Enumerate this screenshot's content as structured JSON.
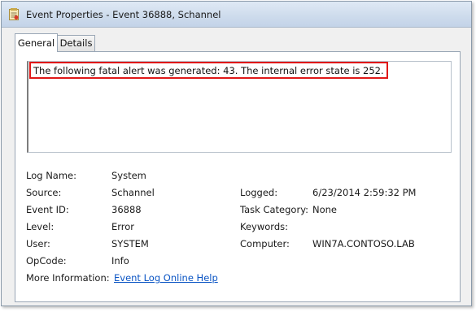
{
  "window": {
    "title": "Event Properties - Event 36888, Schannel",
    "icon": "event-log-icon"
  },
  "tabs": [
    {
      "label": "General",
      "selected": true
    },
    {
      "label": "Details",
      "selected": false
    }
  ],
  "description": "The following fatal alert was generated: 43. The internal error state is 252.",
  "properties": {
    "log_name": {
      "label": "Log Name:",
      "value": "System"
    },
    "source": {
      "label": "Source:",
      "value": "Schannel"
    },
    "event_id": {
      "label": "Event ID:",
      "value": "36888"
    },
    "level": {
      "label": "Level:",
      "value": "Error"
    },
    "user": {
      "label": "User:",
      "value": "SYSTEM"
    },
    "opcode": {
      "label": "OpCode:",
      "value": "Info"
    },
    "more_info": {
      "label": "More Information:",
      "value": "Event Log Online Help"
    },
    "logged": {
      "label": "Logged:",
      "value": "6/23/2014 2:59:32 PM"
    },
    "task_category": {
      "label": "Task Category:",
      "value": "None"
    },
    "keywords": {
      "label": "Keywords:",
      "value": ""
    },
    "computer": {
      "label": "Computer:",
      "value": "WIN7A.CONTOSO.LAB"
    }
  },
  "colors": {
    "highlight_border": "#e01818",
    "link": "#0b55c4"
  }
}
